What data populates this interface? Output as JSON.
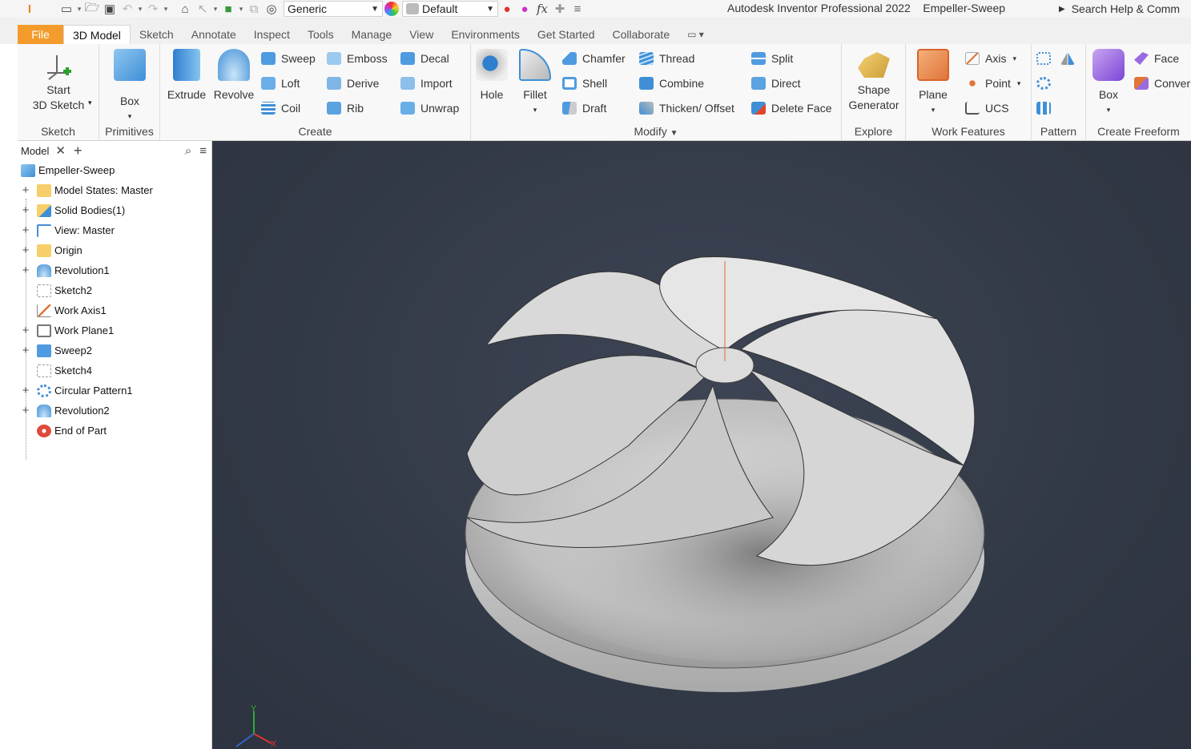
{
  "qat": {
    "material": "Generic",
    "appearance": "Default",
    "fx": "fx"
  },
  "window": {
    "app_title": "Autodesk Inventor Professional 2022",
    "document": "Empeller-Sweep",
    "search_placeholder": "Search Help & Comm"
  },
  "tabs": [
    {
      "label": "File"
    },
    {
      "label": "3D Model"
    },
    {
      "label": "Sketch"
    },
    {
      "label": "Annotate"
    },
    {
      "label": "Inspect"
    },
    {
      "label": "Tools"
    },
    {
      "label": "Manage"
    },
    {
      "label": "View"
    },
    {
      "label": "Environments"
    },
    {
      "label": "Get Started"
    },
    {
      "label": "Collaborate"
    }
  ],
  "ribbon": {
    "sketch": {
      "title": "Sketch",
      "start_line1": "Start",
      "start_line2": "3D Sketch"
    },
    "primitives": {
      "title": "Primitives",
      "box": "Box"
    },
    "create": {
      "title": "Create",
      "extrude": "Extrude",
      "revolve": "Revolve",
      "sweep": "Sweep",
      "loft": "Loft",
      "coil": "Coil",
      "emboss": "Emboss",
      "derive": "Derive",
      "rib": "Rib",
      "decal": "Decal",
      "import": "Import",
      "unwrap": "Unwrap"
    },
    "modify": {
      "title": "Modify",
      "hole": "Hole",
      "fillet": "Fillet",
      "chamfer": "Chamfer",
      "shell": "Shell",
      "draft": "Draft",
      "thread": "Thread",
      "combine": "Combine",
      "thicken": "Thicken/ Offset",
      "split": "Split",
      "direct": "Direct",
      "delete_face": "Delete Face"
    },
    "explore": {
      "title": "Explore",
      "shape_line1": "Shape",
      "shape_line2": "Generator"
    },
    "work_features": {
      "title": "Work Features",
      "plane": "Plane",
      "axis": "Axis",
      "point": "Point",
      "ucs": "UCS"
    },
    "pattern": {
      "title": "Pattern"
    },
    "freeform": {
      "title": "Create Freeform",
      "box": "Box",
      "face": "Face",
      "convert": "Conver"
    }
  },
  "browser": {
    "tab_label": "Model",
    "nodes": [
      {
        "label": "Empeller-Sweep"
      },
      {
        "label": "Model States: Master"
      },
      {
        "label": "Solid Bodies(1)"
      },
      {
        "label": "View: Master"
      },
      {
        "label": "Origin"
      },
      {
        "label": "Revolution1"
      },
      {
        "label": "Sketch2"
      },
      {
        "label": "Work Axis1"
      },
      {
        "label": "Work Plane1"
      },
      {
        "label": "Sweep2"
      },
      {
        "label": "Sketch4"
      },
      {
        "label": "Circular Pattern1"
      },
      {
        "label": "Revolution2"
      },
      {
        "label": "End of Part"
      }
    ]
  },
  "triad": {
    "y": "Y",
    "x": "X"
  },
  "colors": {
    "file_tab": "#f39c2b",
    "viewport_bg": "#343a47",
    "accent_blue": "#3f8fd6"
  }
}
